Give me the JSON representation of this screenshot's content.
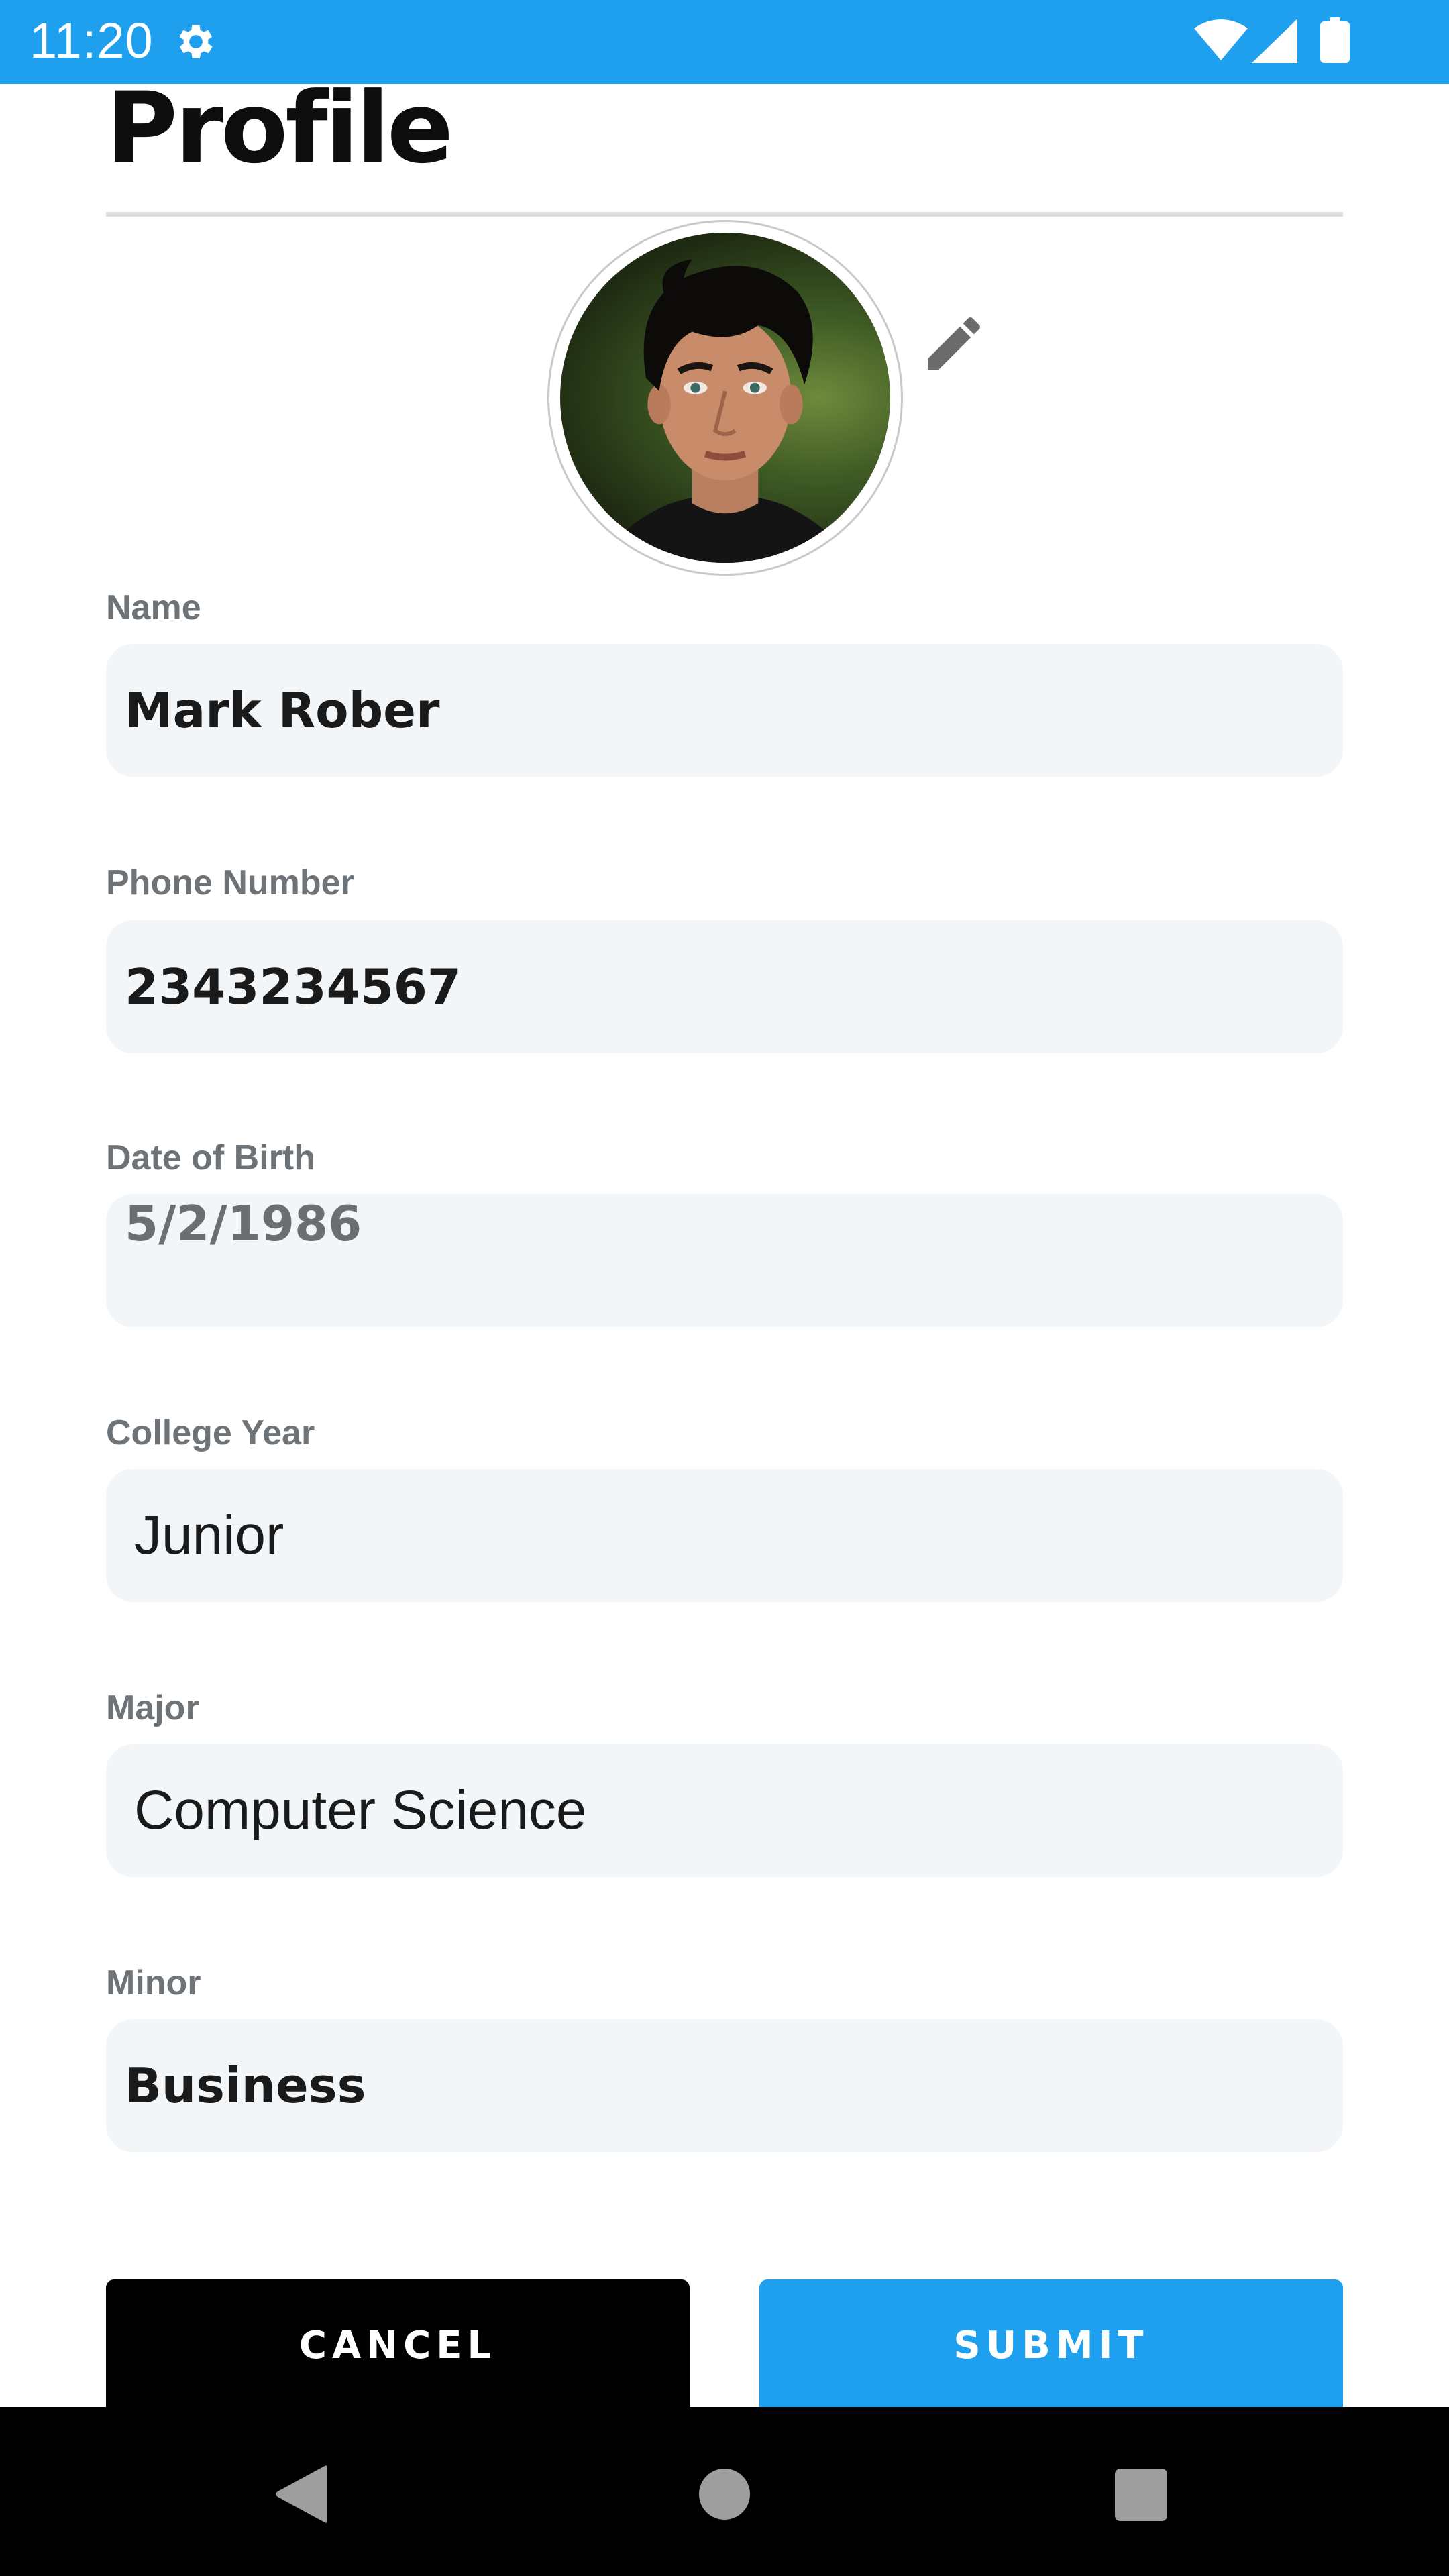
{
  "status_bar": {
    "time": "11:20",
    "icons": [
      "gear-icon",
      "wifi-icon",
      "signal-icon",
      "battery-icon"
    ],
    "color": "#1fa0ee"
  },
  "header": {
    "title": "Profile"
  },
  "avatar": {
    "icon": "pencil-icon"
  },
  "form": {
    "fields": [
      {
        "label": "Name",
        "value": "Mark Rober"
      },
      {
        "label": "Phone Number",
        "value": "2343234567"
      },
      {
        "label": "Date of Birth",
        "value": "5/2/1986"
      },
      {
        "label": "College Year",
        "value": "Junior"
      },
      {
        "label": "Major",
        "value": "Computer Science"
      },
      {
        "label": "Minor",
        "value": "Business"
      }
    ]
  },
  "actions": {
    "cancel_label": "CANCEL",
    "submit_label": "SUBMIT",
    "cancel_color": "#000000",
    "submit_color": "#1fa0ee"
  },
  "nav": {
    "icons": [
      "back-icon",
      "home-icon",
      "recents-icon"
    ]
  }
}
